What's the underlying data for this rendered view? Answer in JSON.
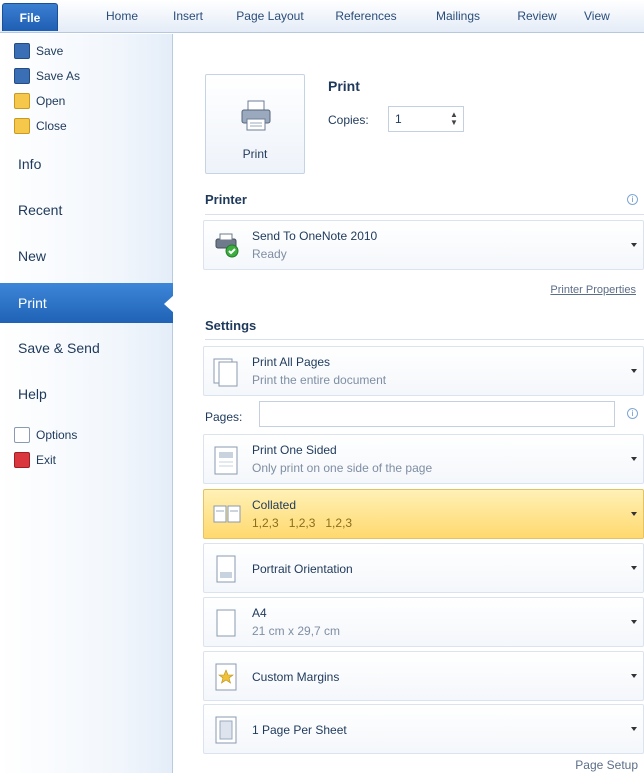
{
  "ribbon": {
    "tabs": [
      "File",
      "Home",
      "Insert",
      "Page Layout",
      "References",
      "Mailings",
      "Review",
      "View"
    ]
  },
  "nav": {
    "small_top": [
      {
        "label": "Save",
        "icon": "save-icon"
      },
      {
        "label": "Save As",
        "icon": "save-as-icon"
      },
      {
        "label": "Open",
        "icon": "open-folder-icon"
      },
      {
        "label": "Close",
        "icon": "close-folder-icon"
      }
    ],
    "big": [
      "Info",
      "Recent",
      "New",
      "Print",
      "Save & Send",
      "Help"
    ],
    "selected": "Print",
    "small_bottom": [
      {
        "label": "Options",
        "icon": "options-icon"
      },
      {
        "label": "Exit",
        "icon": "exit-icon"
      }
    ]
  },
  "print": {
    "button_label": "Print",
    "title": "Print",
    "copies_label": "Copies:",
    "copies_value": "1"
  },
  "printer": {
    "section_title": "Printer",
    "name": "Send To OneNote 2010",
    "status": "Ready",
    "properties_link": "Printer Properties"
  },
  "settings": {
    "section_title": "Settings",
    "print_range": {
      "title": "Print All Pages",
      "subtitle": "Print the entire document"
    },
    "pages_label": "Pages:",
    "pages_value": "",
    "sides": {
      "title": "Print One Sided",
      "subtitle": "Only print on one side of the page"
    },
    "collation": {
      "title": "Collated",
      "subtitle": "1,2,3   1,2,3   1,2,3"
    },
    "orientation": {
      "title": "Portrait Orientation"
    },
    "paper": {
      "title": "A4",
      "subtitle": "21 cm x 29,7 cm"
    },
    "margins": {
      "title": "Custom Margins"
    },
    "per_sheet": {
      "title": "1 Page Per Sheet"
    },
    "page_setup_link": "Page Setup"
  },
  "colors": {
    "file_tab": "#1f5eb3",
    "selected_nav": "#1f62b6",
    "highlight": "#ffd96e"
  }
}
